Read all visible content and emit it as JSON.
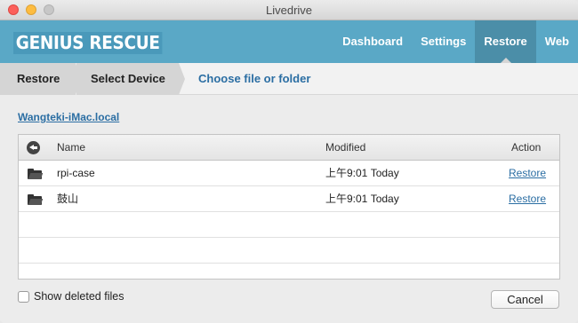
{
  "window": {
    "title": "Livedrive"
  },
  "header": {
    "logo": "GENIUS RESCUE",
    "nav": [
      {
        "label": "Dashboard",
        "active": false
      },
      {
        "label": "Settings",
        "active": false
      },
      {
        "label": "Restore",
        "active": true
      },
      {
        "label": "Web",
        "active": false
      }
    ]
  },
  "breadcrumb": {
    "steps": [
      "Restore",
      "Select Device",
      "Choose file or folder"
    ]
  },
  "device": {
    "name": "Wangteki-iMac.local"
  },
  "table": {
    "columns": [
      "Name",
      "Modified",
      "Action"
    ],
    "rows": [
      {
        "name": "rpi-case",
        "modified": "上午9:01 Today",
        "action": "Restore"
      },
      {
        "name": "鼓山",
        "modified": "上午9:01 Today",
        "action": "Restore"
      }
    ]
  },
  "footer": {
    "show_deleted_label": "Show deleted files",
    "show_deleted_checked": false,
    "cancel_label": "Cancel"
  },
  "colors": {
    "header": "#5aa8c6",
    "active_nav": "#4b8ea8",
    "link": "#2b6ea3"
  }
}
